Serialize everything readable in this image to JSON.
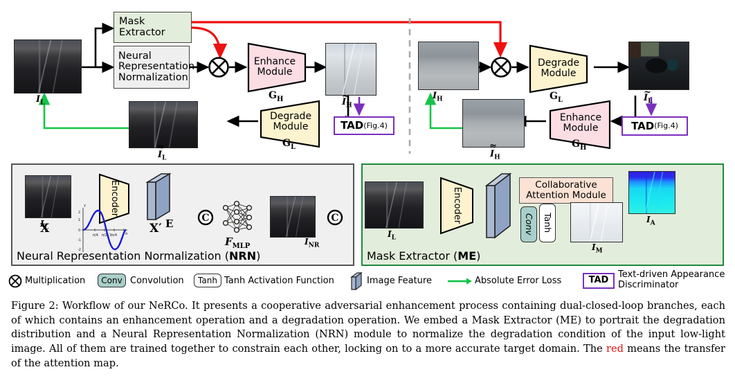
{
  "figure": {
    "id": "Figure 2",
    "domain": "Diagram",
    "caption_prefix": "Figure 2:",
    "caption_part1": " Workflow of our NeRCo. It presents a cooperative adversarial enhancement process containing dual-closed-loop branches, each of which contains an enhancement operation and a degradation operation. We embed a Mask Extractor (ME) to portrait the degradation distribution and a Neural Representation Normalization (NRN) module to normalize the degradation condition of the input low-light image. All of them are trained together to constrain each other, locking on to a more accurate target domain. The ",
    "caption_red_word": "red",
    "caption_part2": " means the transfer of the attention map."
  },
  "top_left_branch": {
    "input_image_label": "I",
    "input_image_sub": "L",
    "mask_extractor": {
      "line1": "Mask",
      "line2": "Extractor"
    },
    "nrn_box": {
      "line1": "Neural",
      "line2": "Representation",
      "line3": "Normalization"
    },
    "multiply_icon": "multiplication-circle",
    "enhance_module": {
      "line1": "Enhance",
      "line2": "Module",
      "symbol": "G",
      "symbol_sub": "H"
    },
    "output_enhanced_label": "I",
    "output_enhanced_sub": "H",
    "degrade_module": {
      "line1": "Degrade",
      "line2": "Module",
      "symbol": "G",
      "symbol_sub": "L"
    },
    "recon_label": "I",
    "recon_sub": "L",
    "tad": {
      "label": "TAD",
      "ref": "(Fig.4)"
    }
  },
  "top_right_branch": {
    "input_image_label": "I",
    "input_image_sub": "H",
    "multiply_icon": "multiplication-circle",
    "degrade_module": {
      "line1": "Degrade",
      "line2": "Module",
      "symbol": "G",
      "symbol_sub": "L"
    },
    "output_degraded_label": "I",
    "output_degraded_sub": "L",
    "enhance_module": {
      "line1": "Enhance",
      "line2": "Module",
      "symbol": "G",
      "symbol_sub": "H"
    },
    "recon_label": "I",
    "recon_sub": "H",
    "tad": {
      "label": "TAD",
      "ref": "(Fig.4)"
    }
  },
  "nrn_panel": {
    "title_plain": "Neural Representation Normalization (",
    "title_bold": "NRN",
    "title_tail": ")",
    "input_label": "I",
    "input_sub": "L",
    "encoder_label": "Encoder",
    "feature_label": "E",
    "coord_label": "X",
    "coord_encoded_label": "X′",
    "concat_icon": "C",
    "mlp_label": "F",
    "mlp_sub": "MLP",
    "output_label": "I",
    "output_sub": "NR",
    "sine_plot": {
      "y_ticks": [
        "2",
        "1",
        "0",
        "-1",
        "-2"
      ],
      "x_ticks": [
        "π/4",
        "π/2",
        "3π/4",
        "π"
      ],
      "y_axis_label": "y",
      "x_axis_label": "x",
      "curve_color": "#1a1ad8"
    }
  },
  "me_panel": {
    "title_plain": "Mask Extractor (",
    "title_bold": "ME",
    "title_tail": ")",
    "input_label": "I",
    "input_sub": "L",
    "encoder_label": "Encoder",
    "cam": {
      "line1": "Collaborative",
      "line2": "Attention Module"
    },
    "conv_label": "Conv",
    "tanh_label": "Tanh",
    "mask_label": "I",
    "mask_sub": "M",
    "attention_label": "I",
    "attention_sub": "A"
  },
  "legend": {
    "items": [
      {
        "icon": "multiplication-circle",
        "label": "Multiplication"
      },
      {
        "icon": "conv-box",
        "glyph": "Conv",
        "label": "Convolution"
      },
      {
        "icon": "tanh-box",
        "glyph": "Tanh",
        "label": "Tanh Activation Function"
      },
      {
        "icon": "image-feature-slab",
        "label": "Image Feature"
      },
      {
        "icon": "green-arrow",
        "label": "Absolute Error Loss"
      },
      {
        "icon": "tad-box",
        "glyph": "TAD",
        "label_line1": "Text-driven  Appearance",
        "label_line2": "Discriminator"
      }
    ]
  },
  "colors": {
    "red_attention": "#ee1111",
    "green_loss": "#16c44a",
    "purple_tad": "#7b2fbe",
    "enhance_pink": "#fbdde4",
    "degrade_cream": "#fdf3cf",
    "me_green": "#e3eddc",
    "nrn_gray": "#efefef",
    "cam_peach": "#fbe2d4",
    "conv_teal": "#a8cfc8",
    "feature_blue": "#8fa4c4"
  }
}
